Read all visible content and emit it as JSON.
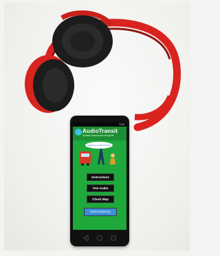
{
  "app": {
    "title": "AudioTransit",
    "subtitle": "Speaker-based audio tour guide",
    "banner": "Welcome to AudioTransit"
  },
  "status_bar": {
    "time": "9:56"
  },
  "menu": {
    "instructions_label": "Instructions",
    "test_audio_label": "Test Audio",
    "check_map_label": "Check Map",
    "start_label": "Start Exploring"
  },
  "colors": {
    "screen_green": "#1fa83c",
    "headphone_red": "#d9231f",
    "primary_button": "#3a8fd9"
  }
}
